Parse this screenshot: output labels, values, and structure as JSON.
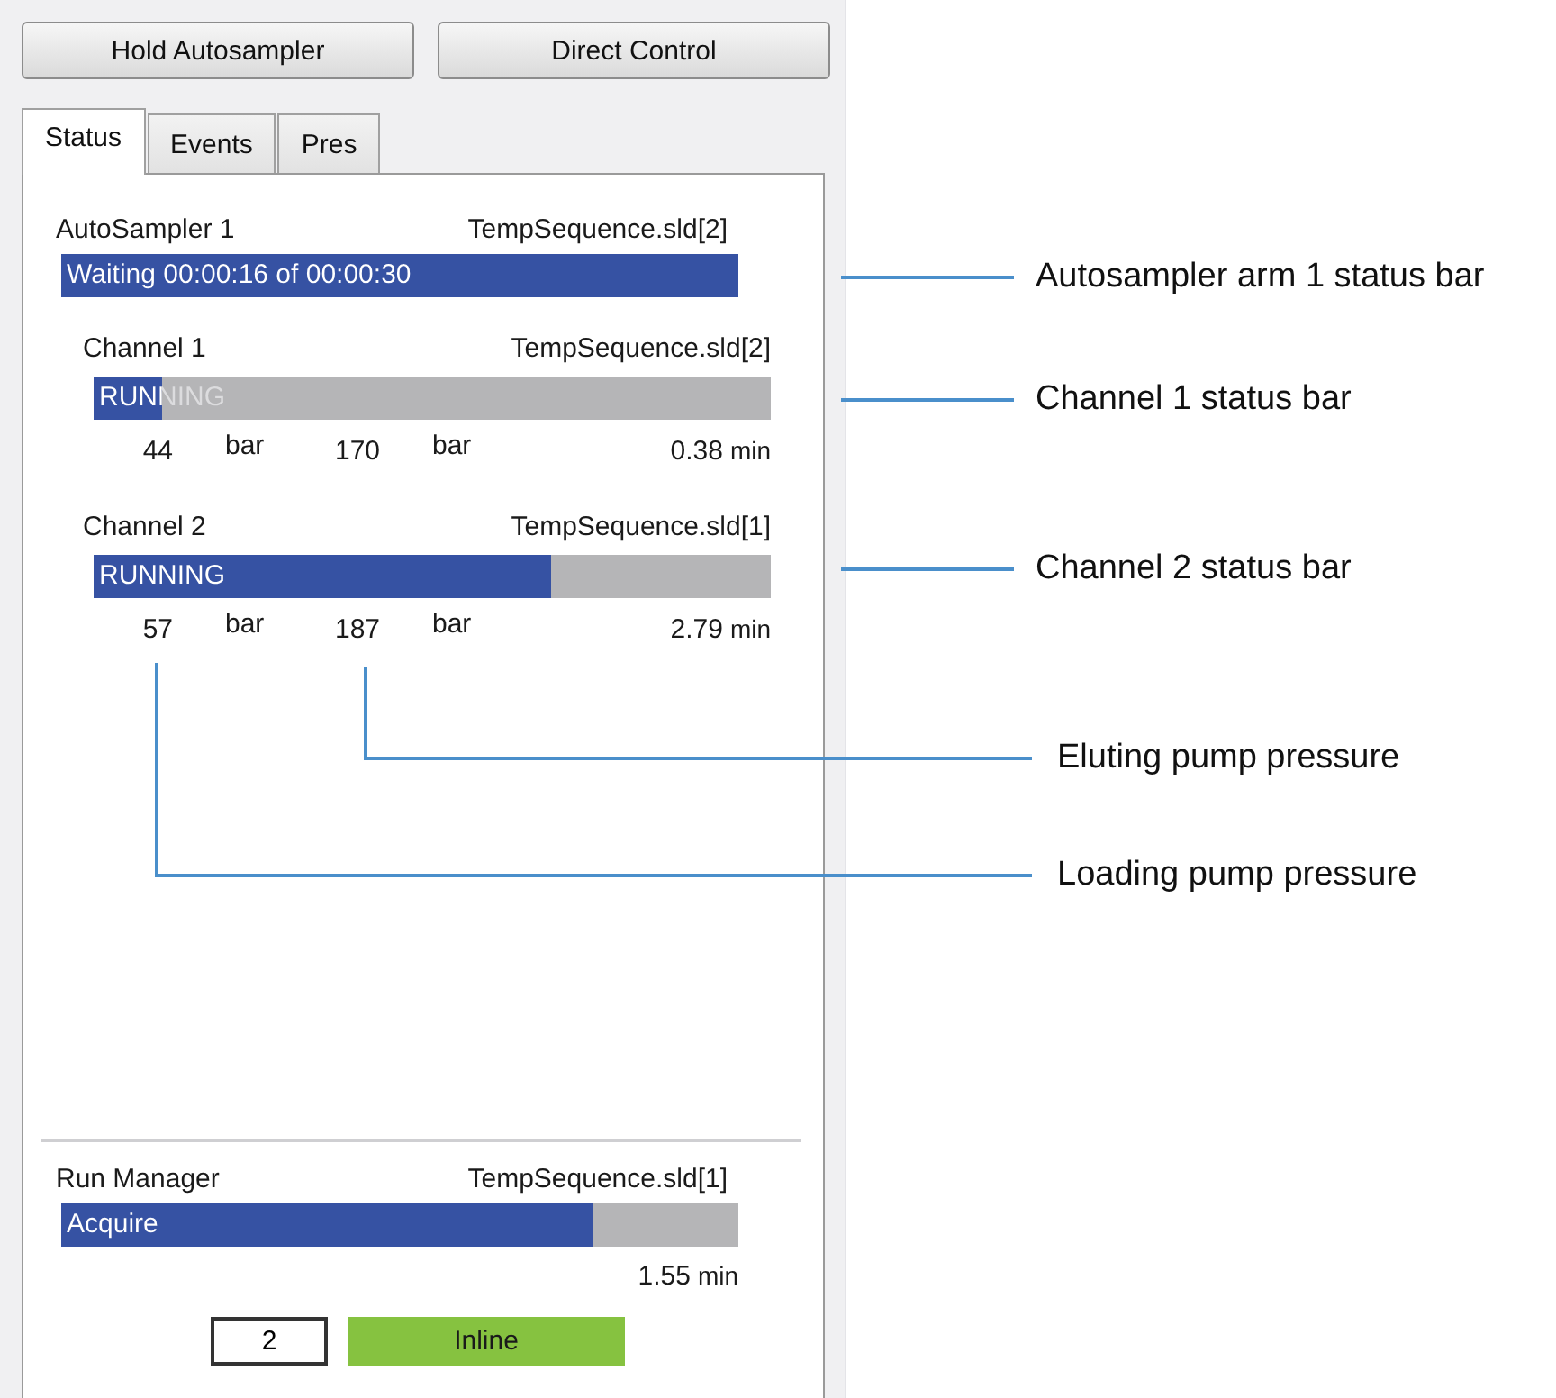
{
  "buttons": [
    {
      "label": "Hold Autosampler"
    },
    {
      "label": "Direct Control"
    }
  ],
  "tabs": [
    {
      "label": "Status",
      "selected": true
    },
    {
      "label": "Events",
      "selected": false
    },
    {
      "label": "Pres",
      "selected": false
    }
  ],
  "autosampler": {
    "name": "AutoSampler 1",
    "sequence": "TempSequence.sld[2]",
    "status": "Waiting 00:00:16 of 00:00:30",
    "level": 1.0
  },
  "channels": [
    {
      "name": "Channel 1",
      "sequence": "TempSequence.sld[2]",
      "status": "RUNNING",
      "level": 0.1,
      "loading_pressure": "44",
      "loading_unit": "bar",
      "eluting_pressure": "170",
      "eluting_unit": "bar",
      "time": "0.38",
      "time_unit": "min"
    },
    {
      "name": "Channel 2",
      "sequence": "TempSequence.sld[1]",
      "status": "RUNNING",
      "level": 0.675,
      "loading_pressure": "57",
      "loading_unit": "bar",
      "eluting_pressure": "187",
      "eluting_unit": "bar",
      "time": "2.79",
      "time_unit": "min"
    }
  ],
  "run_manager": {
    "name": "Run Manager",
    "sequence": "TempSequence.sld[1]",
    "status": "Acquire",
    "level": 0.785,
    "time": "1.55",
    "time_unit": "min",
    "count": "2",
    "mode": "Inline"
  },
  "callouts": [
    {
      "text": "Autosampler arm 1 status bar"
    },
    {
      "text": "Channel 1 status bar"
    },
    {
      "text": "Channel 2 status bar"
    },
    {
      "text": "Eluting pump pressure"
    },
    {
      "text": "Loading pump pressure"
    }
  ]
}
